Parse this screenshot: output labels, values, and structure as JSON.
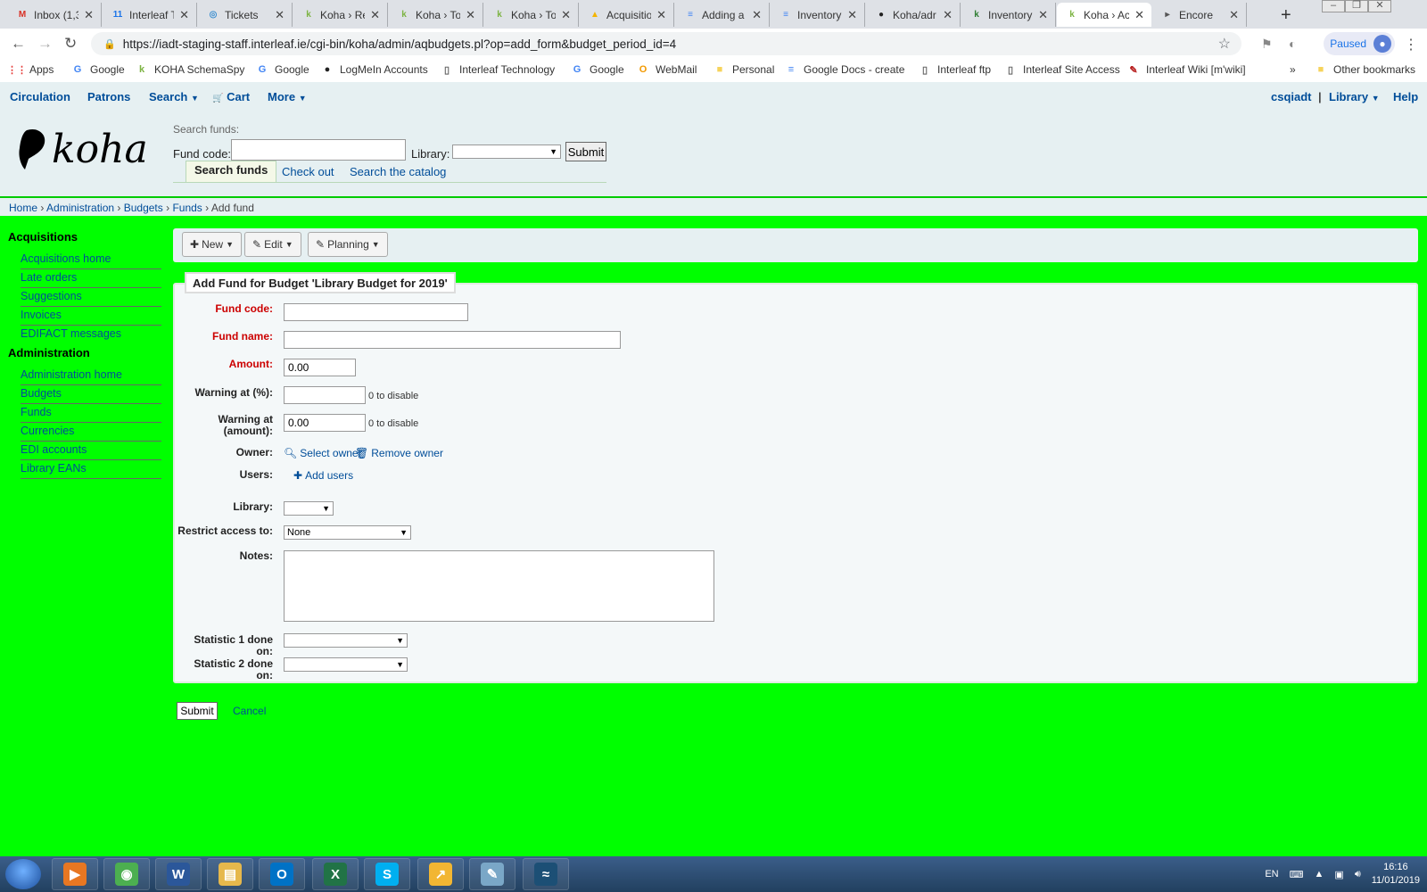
{
  "browser": {
    "tabs": [
      {
        "label": "Inbox (1,3",
        "icon": "gmail-icon",
        "glyph": "M",
        "color": "#d93025"
      },
      {
        "label": "Interleaf T",
        "icon": "calendar-icon",
        "glyph": "11",
        "color": "#1a73e8"
      },
      {
        "label": "Tickets",
        "icon": "globe-icon",
        "glyph": "◎",
        "color": "#3b8ed0"
      },
      {
        "label": "Koha › Re",
        "icon": "koha-icon",
        "glyph": "k",
        "color": "#7cb342"
      },
      {
        "label": "Koha › To",
        "icon": "koha-icon",
        "glyph": "k",
        "color": "#7cb342"
      },
      {
        "label": "Koha › To",
        "icon": "koha-icon",
        "glyph": "k",
        "color": "#7cb342"
      },
      {
        "label": "Acquisitio",
        "icon": "drive-icon",
        "glyph": "▲",
        "color": "#f4b400"
      },
      {
        "label": "Adding a",
        "icon": "docs-icon",
        "glyph": "≡",
        "color": "#4285f4"
      },
      {
        "label": "Inventory",
        "icon": "docs-icon",
        "glyph": "≡",
        "color": "#4285f4"
      },
      {
        "label": "Koha/adr",
        "icon": "github-icon",
        "glyph": "●",
        "color": "#222222"
      },
      {
        "label": "Inventory",
        "icon": "koha-k-icon",
        "glyph": "k",
        "color": "#2e7d32"
      },
      {
        "label": "Koha › Ac",
        "icon": "koha-icon",
        "glyph": "k",
        "color": "#7cb342",
        "active": true
      },
      {
        "label": "Encore",
        "icon": "encore-icon",
        "glyph": "▸",
        "color": "#555555"
      }
    ],
    "url": "https://iadt-staging-staff.interleaf.ie/cgi-bin/koha/admin/aqbudgets.pl?op=add_form&budget_period_id=4",
    "profile_status": "Paused",
    "bookmarks": [
      {
        "label": "Apps",
        "icon": "apps-icon",
        "glyph": "⋮⋮",
        "color": "#e53935"
      },
      {
        "label": "Google",
        "icon": "google-icon",
        "glyph": "G",
        "color": "#4285f4"
      },
      {
        "label": "KOHA SchemaSpy",
        "icon": "koha-icon",
        "glyph": "k",
        "color": "#7cb342"
      },
      {
        "label": "Google",
        "icon": "google-icon",
        "glyph": "G",
        "color": "#4285f4"
      },
      {
        "label": "LogMeIn Accounts",
        "icon": "logmein-icon",
        "glyph": "●",
        "color": "#222222"
      },
      {
        "label": "Interleaf Technology",
        "icon": "page-icon",
        "glyph": "▯",
        "color": "#666666"
      },
      {
        "label": "Google",
        "icon": "google-icon",
        "glyph": "G",
        "color": "#4285f4"
      },
      {
        "label": "WebMail",
        "icon": "webmail-icon",
        "glyph": "O",
        "color": "#f29900"
      },
      {
        "label": "Personal",
        "icon": "folder-icon",
        "glyph": "■",
        "color": "#f6d35b"
      },
      {
        "label": "Google Docs - create",
        "icon": "docs-icon",
        "glyph": "≡",
        "color": "#4285f4"
      },
      {
        "label": "Interleaf ftp",
        "icon": "page-icon",
        "glyph": "▯",
        "color": "#666666"
      },
      {
        "label": "Interleaf Site Access",
        "icon": "page-icon",
        "glyph": "▯",
        "color": "#666666"
      },
      {
        "label": "Interleaf Wiki [m'wiki]",
        "icon": "wiki-icon",
        "glyph": "✎",
        "color": "#b71c1c"
      }
    ],
    "more_bookmarks": "»",
    "other_bookmarks": "Other bookmarks"
  },
  "koha": {
    "topnav": {
      "circulation": "Circulation",
      "patrons": "Patrons",
      "search": "Search",
      "cart": "Cart",
      "more": "More",
      "user": "csqiadt",
      "separator": "|",
      "library": "Library",
      "help": "Help"
    },
    "header": {
      "search_heading": "Search funds:",
      "fund_code_label": "Fund code:",
      "library_label": "Library:",
      "submit": "Submit",
      "tabs": [
        "Search funds",
        "Check out",
        "Search the catalog"
      ]
    },
    "breadcrumbs": [
      "Home",
      "Administration",
      "Budgets",
      "Funds",
      "Add fund"
    ],
    "sidebar": {
      "acquisitions_heading": "Acquisitions",
      "acquisitions_items": [
        "Acquisitions home",
        "Late orders",
        "Suggestions",
        "Invoices",
        "EDIFACT messages"
      ],
      "administration_heading": "Administration",
      "administration_items": [
        "Administration home",
        "Budgets",
        "Funds",
        "Currencies",
        "EDI accounts",
        "Library EANs"
      ]
    },
    "toolbar": {
      "new": "New",
      "edit": "Edit",
      "planning": "Planning"
    },
    "form": {
      "legend": "Add Fund for Budget 'Library Budget for 2019'",
      "fund_code_label": "Fund code:",
      "fund_code_value": "",
      "fund_name_label": "Fund name:",
      "fund_name_value": "",
      "amount_label": "Amount:",
      "amount_value": "0.00",
      "warning_pct_label": "Warning at (%):",
      "warning_pct_value": "",
      "warning_pct_hint": "0 to disable",
      "warning_amt_label": "Warning at (amount):",
      "warning_amt_value": "0.00",
      "warning_amt_hint": "0 to disable",
      "owner_label": "Owner:",
      "select_owner": "Select owner",
      "remove_owner": "Remove owner",
      "users_label": "Users:",
      "add_users": "Add users",
      "library_label": "Library:",
      "library_value": "",
      "restrict_label": "Restrict access to:",
      "restrict_value": "None",
      "notes_label": "Notes:",
      "stat1_label": "Statistic 1 done on:",
      "stat1_value": "",
      "stat2_label": "Statistic 2 done on:",
      "stat2_value": "",
      "submit": "Submit",
      "cancel": "Cancel"
    }
  },
  "taskbar": {
    "apps": [
      {
        "name": "media-player-icon",
        "glyph": "▶",
        "color": "#e87722"
      },
      {
        "name": "chrome-icon",
        "glyph": "◉",
        "color": "#4caf50"
      },
      {
        "name": "word-icon",
        "glyph": "W",
        "color": "#2b579a"
      },
      {
        "name": "explorer-icon",
        "glyph": "▤",
        "color": "#e6b84c"
      },
      {
        "name": "outlook-icon",
        "glyph": "O",
        "color": "#0072c6"
      },
      {
        "name": "excel-icon",
        "glyph": "X",
        "color": "#217346"
      },
      {
        "name": "skype-icon",
        "glyph": "S",
        "color": "#00aff0"
      },
      {
        "name": "ftp-icon",
        "glyph": "↗",
        "color": "#f2b632"
      },
      {
        "name": "notepad-icon",
        "glyph": "✎",
        "color": "#7aa7c7"
      },
      {
        "name": "mysql-icon",
        "glyph": "≈",
        "color": "#1c4f75"
      }
    ],
    "language": "EN",
    "time": "16:16",
    "date": "11/01/2019"
  },
  "colors": {
    "page_background": "#00ff00",
    "link": "#004d99",
    "required": "#cc0000"
  }
}
